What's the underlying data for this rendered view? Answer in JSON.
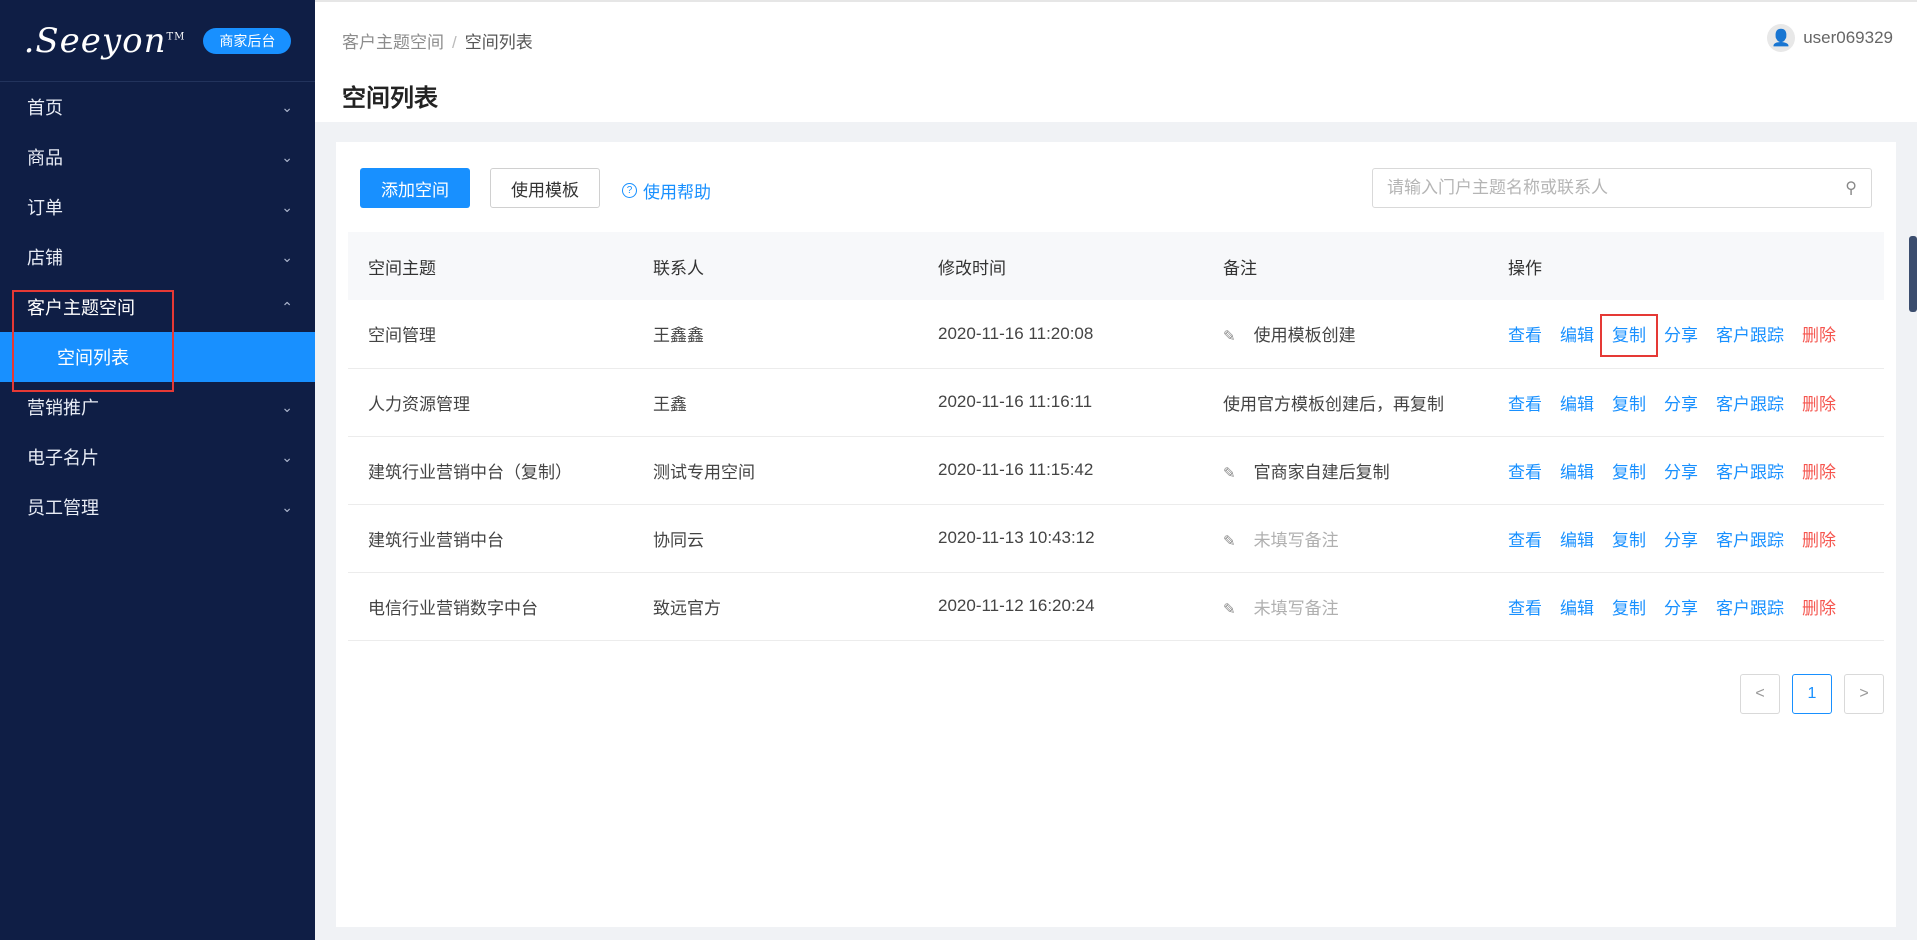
{
  "brand": {
    "logo": ".Seeyon",
    "tm": "TM",
    "badge": "商家后台"
  },
  "sidebar": {
    "items": [
      {
        "label": "首页"
      },
      {
        "label": "商品"
      },
      {
        "label": "订单"
      },
      {
        "label": "店铺"
      },
      {
        "label": "客户主题空间"
      },
      {
        "label": "营销推广"
      },
      {
        "label": "电子名片"
      },
      {
        "label": "员工管理"
      }
    ],
    "active_sub": "空间列表"
  },
  "header": {
    "breadcrumb": [
      "客户主题空间",
      "空间列表"
    ],
    "separator": "/",
    "title": "空间列表",
    "user": "user069329"
  },
  "toolbar": {
    "add_label": "添加空间",
    "template_label": "使用模板",
    "help_label": "使用帮助",
    "search_placeholder": "请输入门户主题名称或联系人"
  },
  "table": {
    "columns": [
      "空间主题",
      "联系人",
      "修改时间",
      "备注",
      "操作"
    ],
    "rows": [
      {
        "topic": "空间管理",
        "contact": "王鑫鑫",
        "time": "2020-11-16 11:20:08",
        "remark": "使用模板创建"
      },
      {
        "topic": "人力资源管理",
        "contact": "王鑫",
        "time": "2020-11-16 11:16:11",
        "remark": "使用官方模板创建后，再复制"
      },
      {
        "topic": "建筑行业营销中台（复制）",
        "contact": "测试专用空间",
        "time": "2020-11-16 11:15:42",
        "remark": "官商家自建后复制"
      },
      {
        "topic": "建筑行业营销中台",
        "contact": "协同云",
        "time": "2020-11-13 10:43:12",
        "remark": "未填写备注"
      },
      {
        "topic": "电信行业营销数字中台",
        "contact": "致远官方",
        "time": "2020-11-12 16:20:24",
        "remark": "未填写备注"
      }
    ],
    "actions": [
      "查看",
      "编辑",
      "复制",
      "分享",
      "客户跟踪",
      "删除"
    ]
  },
  "pagination": {
    "prev": "<",
    "current": "1",
    "next": ">"
  },
  "colors": {
    "sidebar_bg": "#0f1e45",
    "accent": "#1890ff",
    "danger": "#f5564f",
    "highlight": "#e53935"
  }
}
